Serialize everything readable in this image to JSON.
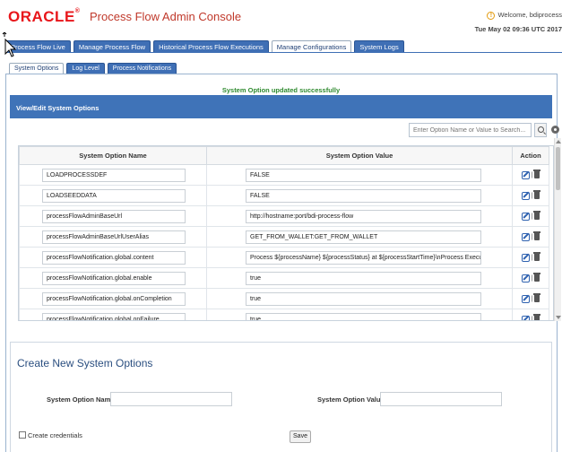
{
  "header": {
    "logo_text": "ORACLE",
    "logo_mark": "®",
    "app_title": "Process Flow Admin Console",
    "welcome": "Welcome, bdiprocess",
    "datetime": "Tue May 02 09:36 UTC 2017"
  },
  "main_tabs": [
    {
      "label": "Process Flow Live"
    },
    {
      "label": "Manage Process Flow"
    },
    {
      "label": "Historical Process Flow Executions"
    },
    {
      "label": "Manage Configurations"
    },
    {
      "label": "System Logs"
    }
  ],
  "sub_tabs": [
    {
      "label": "System Options"
    },
    {
      "label": "Log Level"
    },
    {
      "label": "Process Notifications"
    }
  ],
  "status_message": "System Option updated successfully",
  "panel": {
    "title": "View/Edit System Options",
    "search_placeholder": "Enter Option Name or Value to Search...",
    "columns": {
      "name": "System Option Name",
      "value": "System Option Value",
      "action": "Action"
    },
    "action_separator": "|",
    "rows": [
      {
        "name": "LOADPROCESSDEF",
        "value": "FALSE"
      },
      {
        "name": "LOADSEEDDATA",
        "value": "FALSE"
      },
      {
        "name": "processFlowAdminBaseUrl",
        "value": "http://hostname:port/bdi-process-flow"
      },
      {
        "name": "processFlowAdminBaseUrlUserAlias",
        "value": "GET_FROM_WALLET:GET_FROM_WALLET"
      },
      {
        "name": "processFlowNotification.global.content",
        "value": "Process ${processName} ${processStatus} at ${processStartTime}\\nProcess Execution"
      },
      {
        "name": "processFlowNotification.global.enable",
        "value": "true"
      },
      {
        "name": "processFlowNotification.global.onCompletion",
        "value": "true"
      },
      {
        "name": "processFlowNotification.global.onFailure",
        "value": "true"
      }
    ]
  },
  "create": {
    "title": "Create New System Options",
    "name_label": "System Option Name",
    "value_label": "System Option Value",
    "credentials_label": "Create credentials",
    "save_label": "Save"
  },
  "colors": {
    "brand_red": "#e8161b",
    "tab_blue": "#3f6fb5",
    "panel_header_blue": "#3f73b8",
    "success_green": "#2f8a2f"
  },
  "icons": {
    "search": "search-icon",
    "settings": "gear-icon",
    "edit": "edit-icon",
    "delete": "trash-icon",
    "info": "info-icon",
    "pointer": "mouse-pointer-icon"
  }
}
